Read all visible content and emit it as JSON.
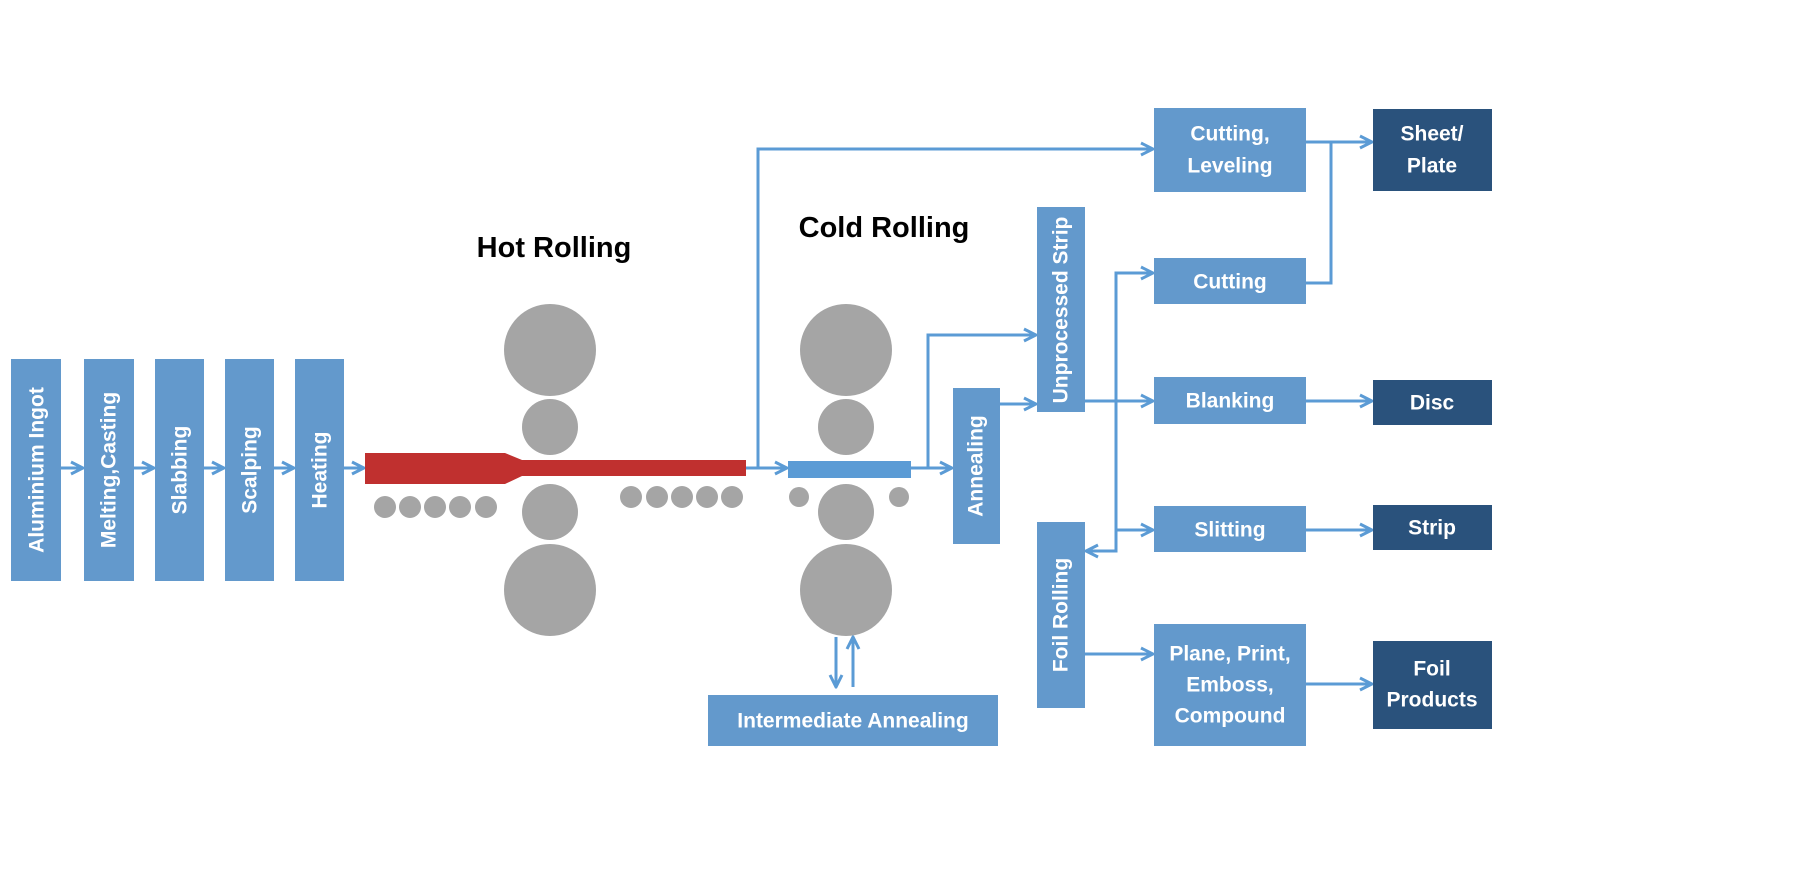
{
  "titles": {
    "hot_rolling": "Hot Rolling",
    "cold_rolling": "Cold Rolling"
  },
  "steps": {
    "ingot": "Aluminium Ingot",
    "melting": "Melting,Casting",
    "slabbing": "Slabbing",
    "scalping": "Scalping",
    "heating": "Heating",
    "annealing": "Annealing",
    "unprocessed": "Unprocessed Strip",
    "foil_rolling": "Foil Rolling",
    "intermediate": "Intermediate Annealing",
    "cutting_leveling": [
      "Cutting,",
      "Leveling"
    ],
    "cutting": "Cutting",
    "blanking": "Blanking",
    "slitting": "Slitting",
    "plane": [
      "Plane, Print,",
      "Emboss,",
      "Compound"
    ]
  },
  "products": {
    "sheet": [
      "Sheet/",
      "Plate"
    ],
    "disc": "Disc",
    "strip": "Strip",
    "foil": [
      "Foil",
      "Products"
    ]
  },
  "colors": {
    "process_box": "#6399cc",
    "product_box": "#2a527c",
    "hot_slab": "#c0302f",
    "cold_strip": "#5b9bd5",
    "roll": "#a5a5a5",
    "arrow": "#5b9bd5"
  }
}
